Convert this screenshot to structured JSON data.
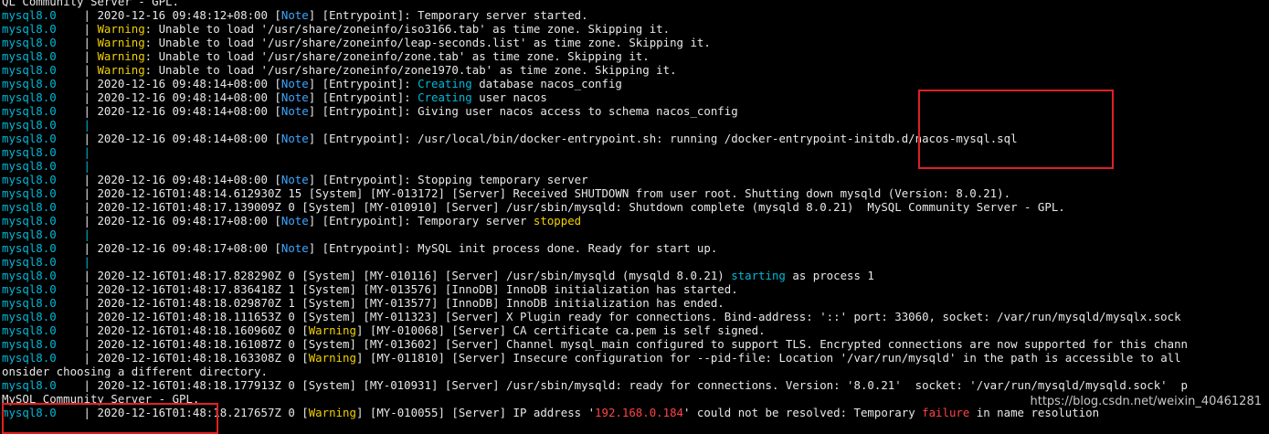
{
  "terminal": {
    "lines": [
      {
        "segments": [
          {
            "t": "QL Community Server - GPL.",
            "c": "white"
          }
        ]
      },
      {
        "segments": [
          {
            "t": "mysql8.0    ",
            "c": "svc"
          },
          {
            "t": "| 2020-12-16 09:48:12+08:00 [",
            "c": "white"
          },
          {
            "t": "Note",
            "c": "note"
          },
          {
            "t": "] [Entrypoint]: Temporary server started.",
            "c": "white"
          }
        ]
      },
      {
        "segments": [
          {
            "t": "mysql8.0    ",
            "c": "svc"
          },
          {
            "t": "| ",
            "c": "white"
          },
          {
            "t": "Warning",
            "c": "warn"
          },
          {
            "t": ": Unable to load '/usr/share/zoneinfo/iso3166.tab' as time zone. Skipping it.",
            "c": "white"
          }
        ]
      },
      {
        "segments": [
          {
            "t": "mysql8.0    ",
            "c": "svc"
          },
          {
            "t": "| ",
            "c": "white"
          },
          {
            "t": "Warning",
            "c": "warn"
          },
          {
            "t": ": Unable to load '/usr/share/zoneinfo/leap-seconds.list' as time zone. Skipping it.",
            "c": "white"
          }
        ]
      },
      {
        "segments": [
          {
            "t": "mysql8.0    ",
            "c": "svc"
          },
          {
            "t": "| ",
            "c": "white"
          },
          {
            "t": "Warning",
            "c": "warn"
          },
          {
            "t": ": Unable to load '/usr/share/zoneinfo/zone.tab' as time zone. Skipping it.",
            "c": "white"
          }
        ]
      },
      {
        "segments": [
          {
            "t": "mysql8.0    ",
            "c": "svc"
          },
          {
            "t": "| ",
            "c": "white"
          },
          {
            "t": "Warning",
            "c": "warn"
          },
          {
            "t": ": Unable to load '/usr/share/zoneinfo/zone1970.tab' as time zone. Skipping it.",
            "c": "white"
          }
        ]
      },
      {
        "segments": [
          {
            "t": "mysql8.0    ",
            "c": "svc"
          },
          {
            "t": "| 2020-12-16 09:48:14+08:00 [",
            "c": "white"
          },
          {
            "t": "Note",
            "c": "note"
          },
          {
            "t": "] [Entrypoint]: ",
            "c": "white"
          },
          {
            "t": "Creating",
            "c": "svc"
          },
          {
            "t": " database nacos_config",
            "c": "white"
          }
        ]
      },
      {
        "segments": [
          {
            "t": "mysql8.0    ",
            "c": "svc"
          },
          {
            "t": "| 2020-12-16 09:48:14+08:00 [",
            "c": "white"
          },
          {
            "t": "Note",
            "c": "note"
          },
          {
            "t": "] [Entrypoint]: ",
            "c": "white"
          },
          {
            "t": "Creating",
            "c": "svc"
          },
          {
            "t": " user nacos",
            "c": "white"
          }
        ]
      },
      {
        "segments": [
          {
            "t": "mysql8.0    ",
            "c": "svc"
          },
          {
            "t": "| 2020-12-16 09:48:14+08:00 [",
            "c": "white"
          },
          {
            "t": "Note",
            "c": "note"
          },
          {
            "t": "] [Entrypoint]: Giving user nacos access to schema nacos_config",
            "c": "white"
          }
        ]
      },
      {
        "segments": [
          {
            "t": "mysql8.0    ",
            "c": "svc"
          },
          {
            "t": "|",
            "c": "svc"
          }
        ]
      },
      {
        "segments": [
          {
            "t": "mysql8.0    ",
            "c": "svc"
          },
          {
            "t": "| 2020-12-16 09:48:14+08:00 [",
            "c": "white"
          },
          {
            "t": "Note",
            "c": "note"
          },
          {
            "t": "] [Entrypoint]: /usr/local/bin/docker-entrypoint.sh: running /docker-entrypoint-initdb.d/nacos-mysql.sql",
            "c": "white"
          }
        ]
      },
      {
        "segments": [
          {
            "t": "mysql8.0    ",
            "c": "svc"
          },
          {
            "t": "|",
            "c": "svc"
          }
        ]
      },
      {
        "segments": [
          {
            "t": "mysql8.0    ",
            "c": "svc"
          },
          {
            "t": "|",
            "c": "svc"
          }
        ]
      },
      {
        "segments": [
          {
            "t": "mysql8.0    ",
            "c": "svc"
          },
          {
            "t": "| 2020-12-16 09:48:14+08:00 [",
            "c": "white"
          },
          {
            "t": "Note",
            "c": "note"
          },
          {
            "t": "] [Entrypoint]: Stopping temporary server",
            "c": "white"
          }
        ]
      },
      {
        "segments": [
          {
            "t": "mysql8.0    ",
            "c": "svc"
          },
          {
            "t": "| 2020-12-16T01:48:14.612930Z 15 [System] [MY-013172] [Server] Received SHUTDOWN from user root. Shutting down mysqld (Version: 8.0.21).",
            "c": "white"
          }
        ]
      },
      {
        "segments": [
          {
            "t": "mysql8.0    ",
            "c": "svc"
          },
          {
            "t": "| 2020-12-16T01:48:17.139009Z 0 [System] [MY-010910] [Server] /usr/sbin/mysqld: Shutdown complete (mysqld 8.0.21)  MySQL Community Server - GPL.",
            "c": "white"
          }
        ]
      },
      {
        "segments": [
          {
            "t": "mysql8.0    ",
            "c": "svc"
          },
          {
            "t": "| 2020-12-16 09:48:17+08:00 [",
            "c": "white"
          },
          {
            "t": "Note",
            "c": "note"
          },
          {
            "t": "] [Entrypoint]: Temporary server ",
            "c": "white"
          },
          {
            "t": "stopped",
            "c": "warn"
          }
        ]
      },
      {
        "segments": [
          {
            "t": "mysql8.0    ",
            "c": "svc"
          },
          {
            "t": "|",
            "c": "svc"
          }
        ]
      },
      {
        "segments": [
          {
            "t": "mysql8.0    ",
            "c": "svc"
          },
          {
            "t": "| 2020-12-16 09:48:17+08:00 [",
            "c": "white"
          },
          {
            "t": "Note",
            "c": "note"
          },
          {
            "t": "] [Entrypoint]: MySQL init process done. Ready for start up.",
            "c": "white"
          }
        ]
      },
      {
        "segments": [
          {
            "t": "mysql8.0    ",
            "c": "svc"
          },
          {
            "t": "|",
            "c": "svc"
          }
        ]
      },
      {
        "segments": [
          {
            "t": "mysql8.0    ",
            "c": "svc"
          },
          {
            "t": "| 2020-12-16T01:48:17.828290Z 0 [System] [MY-010116] [Server] /usr/sbin/mysqld (mysqld 8.0.21) ",
            "c": "white"
          },
          {
            "t": "starting",
            "c": "svc"
          },
          {
            "t": " as process 1",
            "c": "white"
          }
        ]
      },
      {
        "segments": [
          {
            "t": "mysql8.0    ",
            "c": "svc"
          },
          {
            "t": "| 2020-12-16T01:48:17.836418Z 1 [System] [MY-013576] [InnoDB] InnoDB initialization has started.",
            "c": "white"
          }
        ]
      },
      {
        "segments": [
          {
            "t": "mysql8.0    ",
            "c": "svc"
          },
          {
            "t": "| 2020-12-16T01:48:18.029870Z 1 [System] [MY-013577] [InnoDB] InnoDB initialization has ended.",
            "c": "white"
          }
        ]
      },
      {
        "segments": [
          {
            "t": "mysql8.0    ",
            "c": "svc"
          },
          {
            "t": "| 2020-12-16T01:48:18.111653Z 0 [System] [MY-011323] [Server] X Plugin ready for connections. Bind-address: '::' port: 33060, socket: /var/run/mysqld/mysqlx.sock",
            "c": "white"
          }
        ]
      },
      {
        "segments": [
          {
            "t": "mysql8.0    ",
            "c": "svc"
          },
          {
            "t": "| 2020-12-16T01:48:18.160960Z 0 [",
            "c": "white"
          },
          {
            "t": "Warning",
            "c": "warn"
          },
          {
            "t": "] [MY-010068] [Server] CA certificate ca.pem is self signed.",
            "c": "white"
          }
        ]
      },
      {
        "segments": [
          {
            "t": "mysql8.0    ",
            "c": "svc"
          },
          {
            "t": "| 2020-12-16T01:48:18.161087Z 0 [System] [MY-013602] [Server] Channel mysql_main configured to support TLS. Encrypted connections are now supported for this chann",
            "c": "white"
          }
        ]
      },
      {
        "segments": [
          {
            "t": "mysql8.0    ",
            "c": "svc"
          },
          {
            "t": "| 2020-12-16T01:48:18.163308Z 0 [",
            "c": "white"
          },
          {
            "t": "Warning",
            "c": "warn"
          },
          {
            "t": "] [MY-011810] [Server] Insecure configuration for --pid-file: Location '/var/run/mysqld' in the path is accessible to all",
            "c": "white"
          }
        ]
      },
      {
        "segments": [
          {
            "t": "onsider choosing a different directory.",
            "c": "white"
          }
        ]
      },
      {
        "segments": [
          {
            "t": "mysql8.0    ",
            "c": "svc"
          },
          {
            "t": "| 2020-12-16T01:48:18.177913Z 0 [System] [MY-010931] [Server] /usr/sbin/mysqld: ready for connections. Version: '8.0.21'  socket: '/var/run/mysqld/mysqld.sock'  p",
            "c": "white"
          }
        ]
      },
      {
        "segments": [
          {
            "t": "MySQL Community Server - GPL.",
            "c": "white"
          }
        ]
      },
      {
        "segments": [
          {
            "t": "mysql8.0    ",
            "c": "svc"
          },
          {
            "t": "| 2020-12-16T01:48:18.217657Z 0 [",
            "c": "white"
          },
          {
            "t": "Warning",
            "c": "warn"
          },
          {
            "t": "] [MY-010055] [Server] IP address '",
            "c": "white"
          },
          {
            "t": "192.168.0.184",
            "c": "red"
          },
          {
            "t": "' could not be resolved: Temporary ",
            "c": "white"
          },
          {
            "t": "failure",
            "c": "red"
          },
          {
            "t": " in name resolution",
            "c": "white"
          }
        ]
      }
    ]
  },
  "annotations": {
    "box_sql_label": "highlight-initdb-sql",
    "box_ready_label": "highlight-ready-for-connections"
  },
  "watermark": "https://blog.csdn.net/weixin_40461281",
  "colors": {
    "background": "#000000",
    "service": "#00b8d8",
    "warning": "#f0d000",
    "note": "#3fa5ff",
    "error": "#ff4444",
    "text": "#ffffff",
    "highlight_box": "#e02020"
  }
}
